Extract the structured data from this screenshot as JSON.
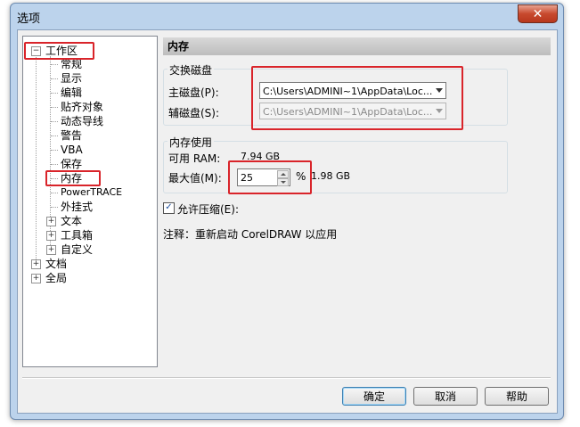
{
  "window": {
    "title": "选项",
    "close_glyph": "✕"
  },
  "tree": {
    "workspace": "工作区",
    "children": [
      "常规",
      "显示",
      "编辑",
      "贴齐对象",
      "动态导线",
      "警告",
      "VBA",
      "保存",
      "内存",
      "PowerTRACE",
      "外挂式"
    ],
    "expandable_children": [
      "文本",
      "工具箱",
      "自定义"
    ],
    "roots": [
      "文档",
      "全局"
    ],
    "expander_collapsed": "+",
    "expander_expanded": "−"
  },
  "panel": {
    "header": "内存",
    "swap": {
      "group_label": "交换磁盘",
      "primary_label": "主磁盘(P):",
      "primary_value": "C:\\Users\\ADMINI~1\\AppData\\Loc...",
      "secondary_label": "辅磁盘(S):",
      "secondary_value": "C:\\Users\\ADMINI~1\\AppData\\Loc..."
    },
    "memory": {
      "group_label": "内存使用",
      "available_label": "可用 RAM:",
      "available_value": "7.94 GB",
      "max_label": "最大值(M):",
      "max_value": "25",
      "percent": "%",
      "max_size": "1.98 GB"
    },
    "compress": {
      "label": "允许压缩(E):",
      "checked_glyph": "✓"
    },
    "note": "注释：重新启动 CorelDRAW 以应用"
  },
  "buttons": {
    "ok": "确定",
    "cancel": "取消",
    "help": "帮助"
  },
  "colors": {
    "highlight_red": "#d9242a"
  }
}
